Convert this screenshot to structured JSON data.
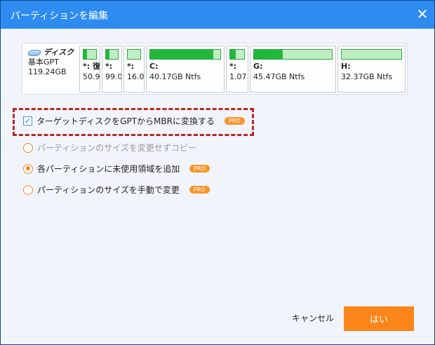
{
  "window": {
    "title": "パーティションを編集",
    "close_icon": "close-icon"
  },
  "disk": {
    "name": "ディスク",
    "type": "基本GPT",
    "size": "119.24GB",
    "icon": "disk-icon",
    "partitions": [
      {
        "label": "*: 復",
        "size": "50.9",
        "used_fraction": 0.3
      },
      {
        "label": "*:",
        "size": "99.0",
        "used_fraction": 0.3
      },
      {
        "label": "*:",
        "size": "16.0",
        "used_fraction": 0
      },
      {
        "label": "C:",
        "size": "40.17GB Ntfs",
        "used_fraction": 0.9
      },
      {
        "label": "*:",
        "size": "1.07",
        "used_fraction": 0.42
      },
      {
        "label": "G:",
        "size": "45.47GB Ntfs",
        "used_fraction": 0.37
      },
      {
        "label": "H:",
        "size": "32.37GB Ntfs",
        "used_fraction": 0
      }
    ]
  },
  "options": {
    "convert": {
      "label": "ターゲットディスクをGPTからMBRに変換する",
      "checked": true,
      "badge": "PRO"
    },
    "radios": [
      {
        "label": "パーティションのサイズを変更せずコピー",
        "selected": false,
        "disabled": true
      },
      {
        "label": "各パーティションに未使用領域を追加",
        "selected": true,
        "badge": "PRO"
      },
      {
        "label": "パーティションのサイズを手動で変更",
        "selected": false,
        "badge": "PRO"
      }
    ]
  },
  "buttons": {
    "cancel": "キャンセル",
    "ok": "はい"
  },
  "colors": {
    "title_bar": "#2e8cf0",
    "accent": "#fb8518",
    "used": "#22b83d"
  }
}
